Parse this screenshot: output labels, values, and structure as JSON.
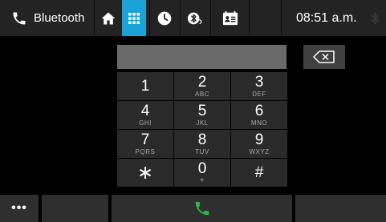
{
  "header": {
    "title": "Bluetooth",
    "phone_icon": "phone-icon",
    "home_icon": "home-icon",
    "keypad_icon": "keypad-icon",
    "recent_icon": "recent-calls-clock-icon",
    "bt_settings_icon": "bluetooth-settings-icon",
    "contacts_icon": "contacts-icon",
    "clock": "08:51 a.m.",
    "bt_status_icon": "bluetooth-status-icon",
    "active_tab_color": "#1ba2d8"
  },
  "dialer": {
    "number": "",
    "backspace_icon": "backspace-icon"
  },
  "keys": [
    {
      "digit": "1",
      "letters": ""
    },
    {
      "digit": "2",
      "letters": "ABC"
    },
    {
      "digit": "3",
      "letters": "DEF"
    },
    {
      "digit": "4",
      "letters": "GHI"
    },
    {
      "digit": "5",
      "letters": "JKL"
    },
    {
      "digit": "6",
      "letters": "MNO"
    },
    {
      "digit": "7",
      "letters": "PQRS"
    },
    {
      "digit": "8",
      "letters": "TUV"
    },
    {
      "digit": "9",
      "letters": "WXYZ"
    },
    {
      "digit": "∗",
      "letters": ""
    },
    {
      "digit": "0",
      "letters": "+"
    },
    {
      "digit": "#",
      "letters": ""
    }
  ],
  "footer": {
    "more_label": "•••",
    "call_icon": "call-icon",
    "call_color": "#2db34a"
  }
}
